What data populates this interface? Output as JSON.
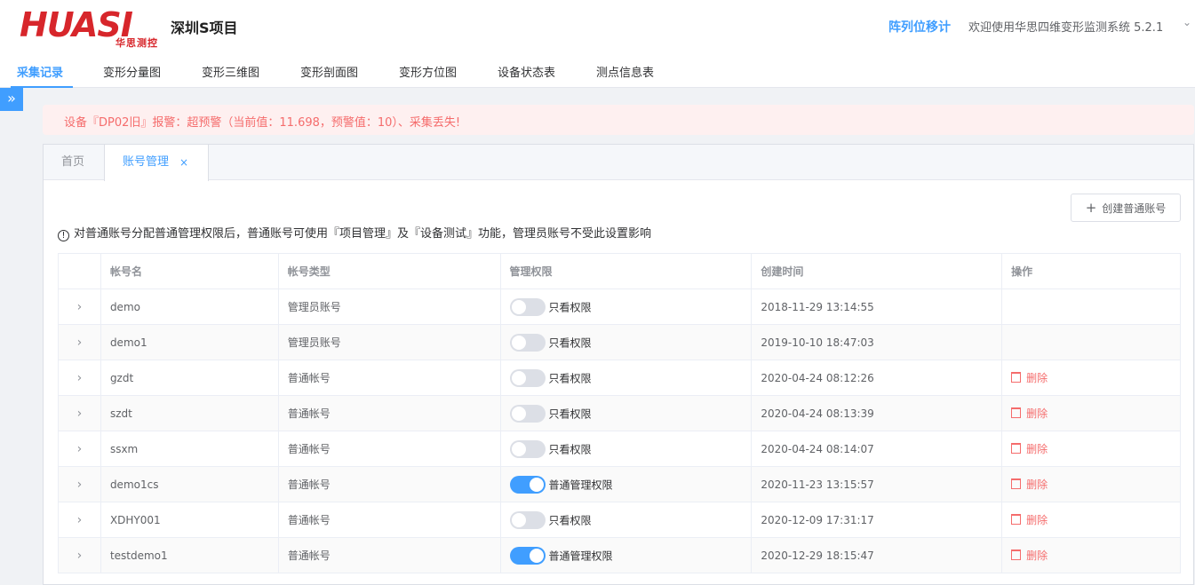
{
  "header": {
    "logo_text": "HUASI",
    "logo_sub": "华思测控",
    "project_name": "深圳S项目",
    "link": "阵列位移计",
    "welcome": "欢迎使用华思四维变形监测系统 5.2.1"
  },
  "nav": {
    "items": [
      "采集记录",
      "变形分量图",
      "变形三维图",
      "变形剖面图",
      "变形方位图",
      "设备状态表",
      "测点信息表"
    ]
  },
  "alert": {
    "text": "设备『DP02旧』报警：超预警（当前值：11.698，预警值：10）、采集丢失!"
  },
  "tabs": {
    "home": "首页",
    "active": "账号管理",
    "close": "×"
  },
  "create_button": "创建普通账号",
  "notice": "对普通账号分配普通管理权限后，普通账号可使用『项目管理』及『设备测试』功能，管理员账号不受此设置影响",
  "table": {
    "headers": [
      "帐号名",
      "帐号类型",
      "管理权限",
      "创建时间",
      "操作"
    ],
    "rows": [
      {
        "name": "demo",
        "type": "管理员账号",
        "perm": "只看权限",
        "perm_on": false,
        "created": "2018-11-29 13:14:55",
        "action": ""
      },
      {
        "name": "demo1",
        "type": "管理员账号",
        "perm": "只看权限",
        "perm_on": false,
        "created": "2019-10-10 18:47:03",
        "action": ""
      },
      {
        "name": "gzdt",
        "type": "普通帐号",
        "perm": "只看权限",
        "perm_on": false,
        "created": "2020-04-24 08:12:26",
        "action": "删除"
      },
      {
        "name": "szdt",
        "type": "普通帐号",
        "perm": "只看权限",
        "perm_on": false,
        "created": "2020-04-24 08:13:39",
        "action": "删除"
      },
      {
        "name": "ssxm",
        "type": "普通帐号",
        "perm": "只看权限",
        "perm_on": false,
        "created": "2020-04-24 08:14:07",
        "action": "删除"
      },
      {
        "name": "demo1cs",
        "type": "普通帐号",
        "perm": "普通管理权限",
        "perm_on": true,
        "created": "2020-11-23 13:15:57",
        "action": "删除"
      },
      {
        "name": "XDHY001",
        "type": "普通帐号",
        "perm": "只看权限",
        "perm_on": false,
        "created": "2020-12-09 17:31:17",
        "action": "删除"
      },
      {
        "name": "testdemo1",
        "type": "普通帐号",
        "perm": "普通管理权限",
        "perm_on": true,
        "created": "2020-12-29 18:15:47",
        "action": "删除"
      }
    ]
  },
  "colors": {
    "accent": "#409eff",
    "danger": "#f56c6c",
    "brand": "#d7262b"
  }
}
